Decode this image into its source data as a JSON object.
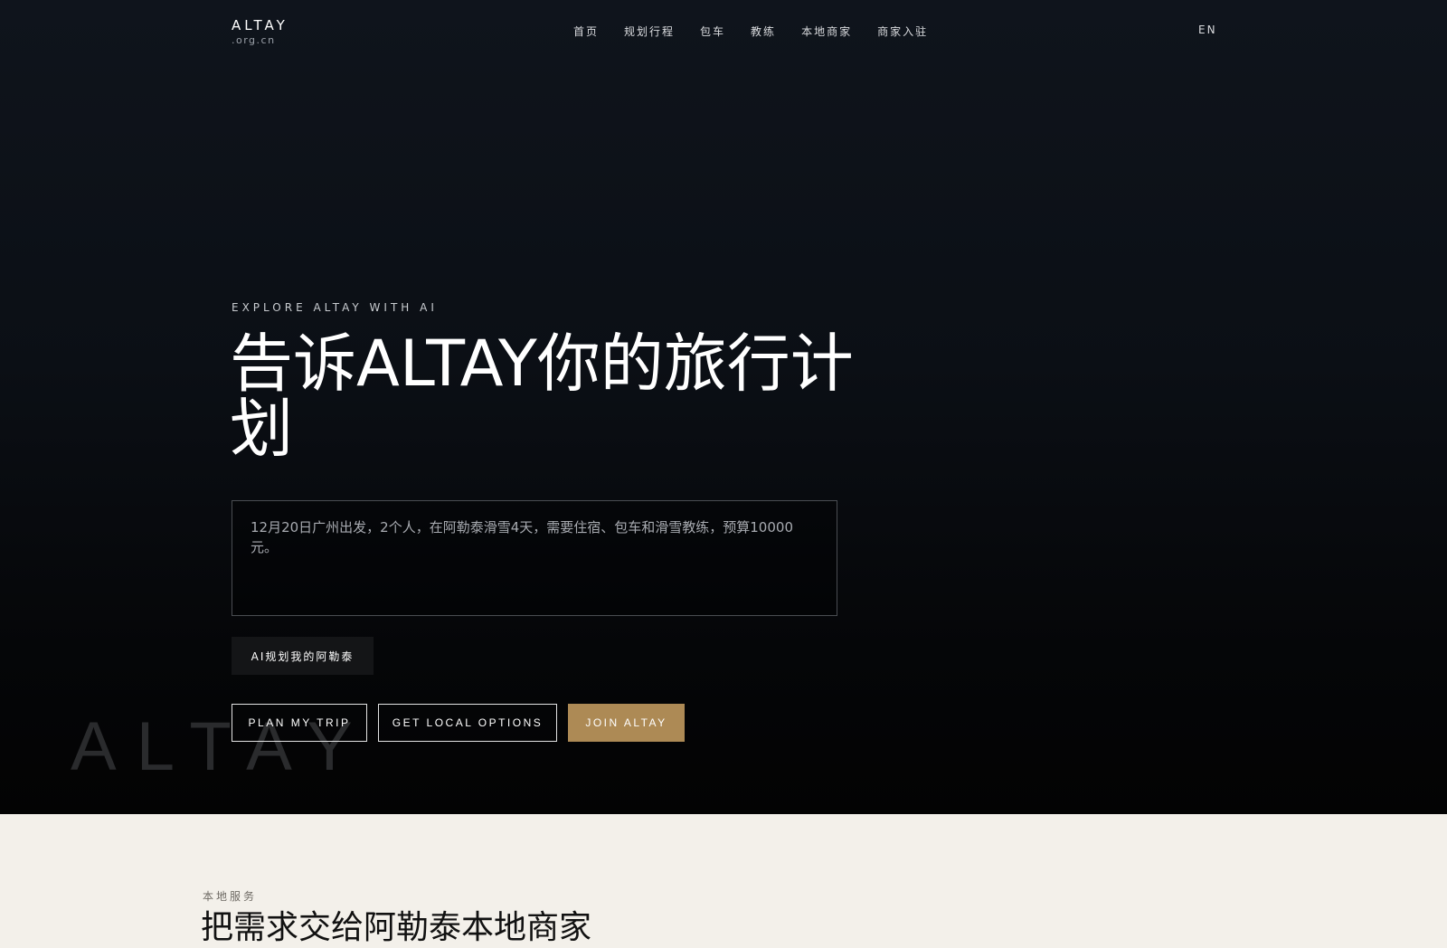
{
  "brand": {
    "name": "ALTAY",
    "domain": ".org.cn"
  },
  "nav": {
    "items": [
      "首页",
      "规划行程",
      "包车",
      "教练",
      "本地商家",
      "商家入驻"
    ],
    "lang": "EN"
  },
  "hero": {
    "eyebrow": "EXPLORE ALTAY WITH AI",
    "headline": "告诉ALTAY你的旅行计划",
    "prompt_value": "12月20日广州出发，2个人，在阿勒泰滑雪4天，需要住宿、包车和滑雪教练，预算10000元。",
    "ai_button": "AI规划我的阿勒泰",
    "watermark": "ALTAY",
    "cta": {
      "plan": "PLAN MY TRIP",
      "local": "GET LOCAL OPTIONS",
      "join": "JOIN ALTAY"
    }
  },
  "services": {
    "eyebrow": "本地服务",
    "title": "把需求交给阿勒泰本地商家"
  },
  "colors": {
    "accent_gold": "#ad8a55",
    "hero_bg": "#0b0f15",
    "section_bg": "#f3f0ea"
  }
}
